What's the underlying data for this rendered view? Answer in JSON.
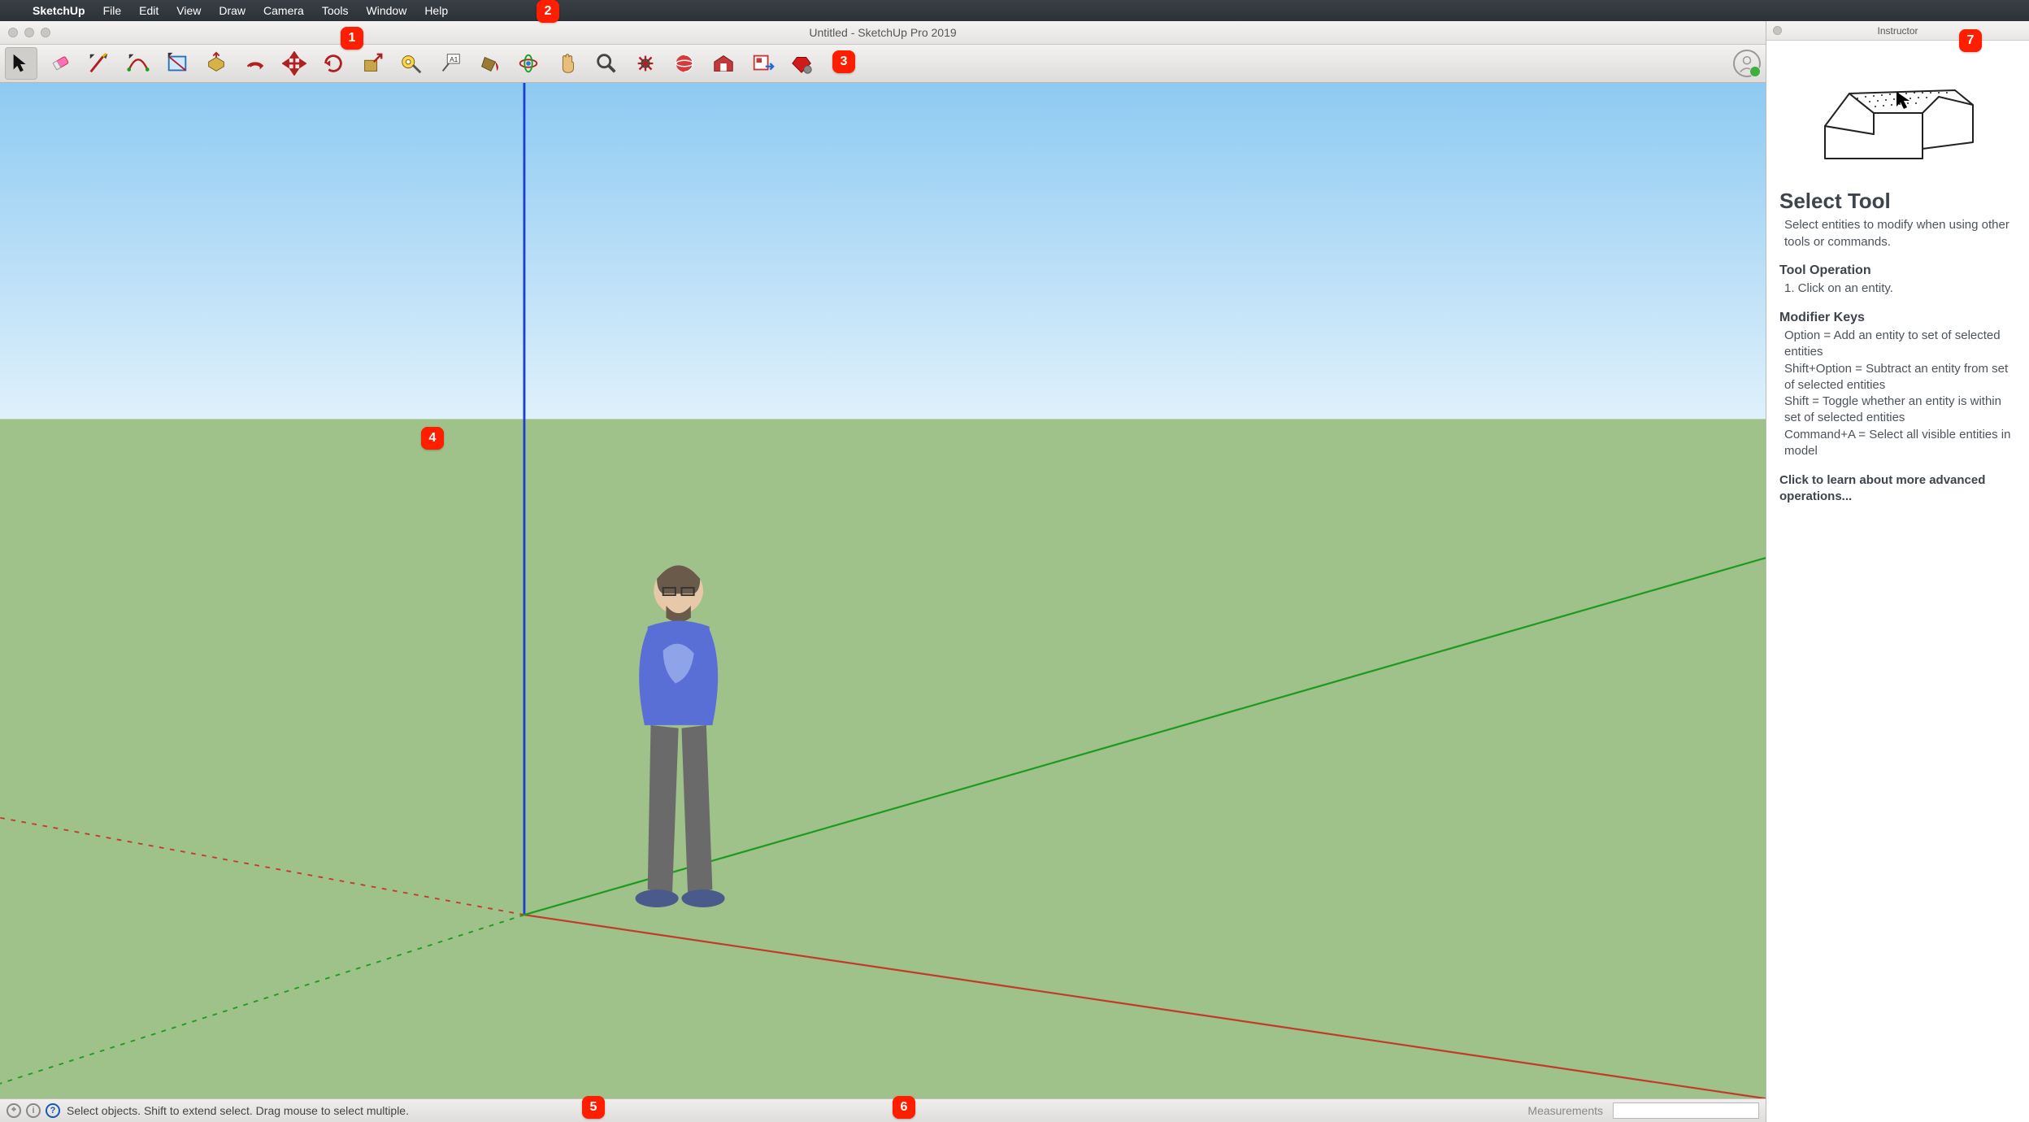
{
  "os_menu": {
    "apple": "",
    "appname": "SketchUp",
    "items": [
      "File",
      "Edit",
      "View",
      "Draw",
      "Camera",
      "Tools",
      "Window",
      "Help"
    ]
  },
  "window": {
    "title": "Untitled - SketchUp Pro 2019"
  },
  "toolbar": {
    "tools": [
      {
        "name": "select",
        "label": "Select",
        "selected": true
      },
      {
        "name": "eraser",
        "label": "Eraser"
      },
      {
        "name": "line",
        "label": "Line"
      },
      {
        "name": "arc",
        "label": "Arc"
      },
      {
        "name": "rectangle",
        "label": "Shapes"
      },
      {
        "name": "pushpull",
        "label": "Push/Pull"
      },
      {
        "name": "offset",
        "label": "Offset"
      },
      {
        "name": "move",
        "label": "Move"
      },
      {
        "name": "rotate",
        "label": "Rotate"
      },
      {
        "name": "scale",
        "label": "Scale"
      },
      {
        "name": "tape",
        "label": "Tape Measure"
      },
      {
        "name": "text",
        "label": "Text"
      },
      {
        "name": "paint",
        "label": "Paint Bucket"
      },
      {
        "name": "orbit",
        "label": "Orbit"
      },
      {
        "name": "pan",
        "label": "Pan"
      },
      {
        "name": "zoom",
        "label": "Zoom"
      },
      {
        "name": "zoom-extents",
        "label": "Zoom Extents"
      },
      {
        "name": "add-location",
        "label": "Add Location"
      },
      {
        "name": "warehouse",
        "label": "3D Warehouse"
      },
      {
        "name": "layout",
        "label": "Send to LayOut"
      },
      {
        "name": "extensions",
        "label": "Extension Warehouse"
      }
    ]
  },
  "statusbar": {
    "hint": "Select objects. Shift to extend select. Drag mouse to select multiple.",
    "measurements_label": "Measurements",
    "measurements_value": ""
  },
  "instructor": {
    "panel_title": "Instructor",
    "tool_title": "Select Tool",
    "tool_description": "Select entities to modify when using other tools or commands.",
    "operation_heading": "Tool Operation",
    "operation_step": "1. Click on an entity.",
    "modifiers_heading": "Modifier Keys",
    "modifiers": [
      "Option = Add an entity to set of selected entities",
      "Shift+Option = Subtract an entity from set of selected entities",
      "Shift = Toggle whether an entity is within set of selected entities",
      "Command+A = Select all visible entities in model"
    ],
    "learn_more": "Click to learn about more advanced operations..."
  },
  "callouts": {
    "1": "1",
    "2": "2",
    "3": "3",
    "4": "4",
    "5": "5",
    "6": "6",
    "7": "7"
  }
}
